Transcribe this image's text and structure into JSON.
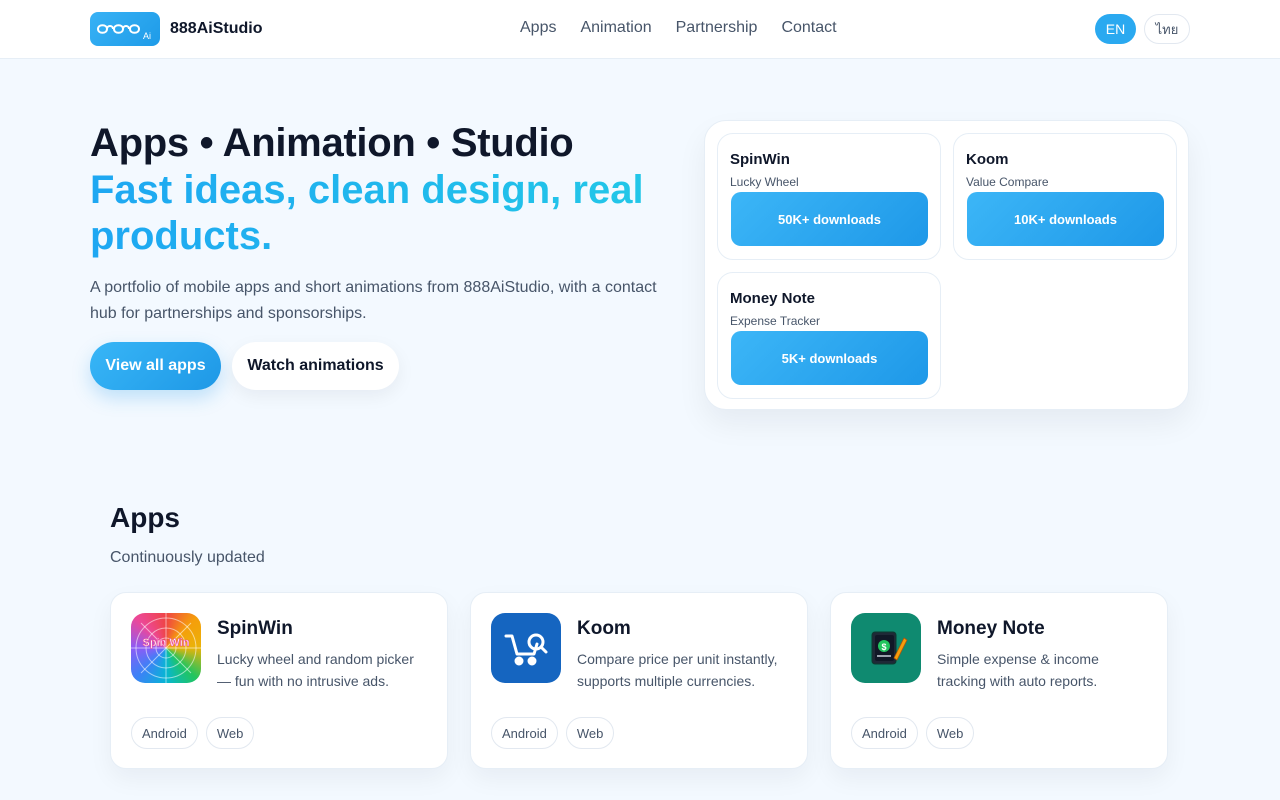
{
  "header": {
    "brand": "888AiStudio",
    "logo_text": "Ai",
    "nav": [
      "Apps",
      "Animation",
      "Partnership",
      "Contact"
    ],
    "lang_en": "EN",
    "lang_th": "ไทย"
  },
  "hero": {
    "title": "Apps • Animation • Studio",
    "subtitle": "Fast ideas, clean design, real products.",
    "description": "A portfolio of mobile apps and short animations from 888AiStudio, with a contact hub for partnerships and sponsorships.",
    "primary_button": "View all apps",
    "secondary_button": "Watch animations"
  },
  "stats": [
    {
      "name": "SpinWin",
      "tag": "Lucky Wheel",
      "downloads": "50K+ downloads"
    },
    {
      "name": "Koom",
      "tag": "Value Compare",
      "downloads": "10K+ downloads"
    },
    {
      "name": "Money Note",
      "tag": "Expense Tracker",
      "downloads": "5K+ downloads"
    }
  ],
  "apps_section": {
    "title": "Apps",
    "subtitle": "Continuously updated",
    "apps": [
      {
        "name": "SpinWin",
        "icon": "color-wheel-icon",
        "icon_text": "Spin Win",
        "description": "Lucky wheel and random picker — fun with no intrusive ads.",
        "platforms": [
          "Android",
          "Web"
        ],
        "color": "#f472b6"
      },
      {
        "name": "Koom",
        "icon": "cart-search-icon",
        "description": "Compare price per unit instantly, supports multiple currencies.",
        "platforms": [
          "Android",
          "Web"
        ],
        "color": "#1565c0"
      },
      {
        "name": "Money Note",
        "icon": "money-notebook-icon",
        "description": "Simple expense & income tracking with auto reports.",
        "platforms": [
          "Android",
          "Web"
        ],
        "color": "#0f8a70"
      }
    ]
  }
}
